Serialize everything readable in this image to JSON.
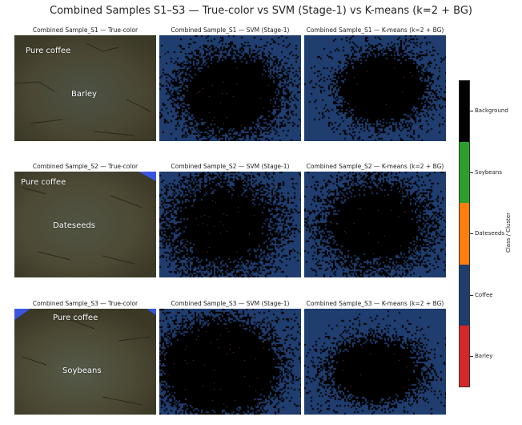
{
  "figure": {
    "title": "Combined Samples S1–S3 — True-color vs SVM (Stage-1) vs K-means (k=2 + BG)"
  },
  "rows": [
    {
      "sample": "S1",
      "truecolor_title": "Combined Sample_S1 — True-color",
      "svm_title": "Combined Sample_S1 — SVM (Stage-1)",
      "kmeans_title": "Combined Sample_S1 — K-means (k=2 + BG)",
      "label_top": "Pure coffee",
      "label_center": "Barley"
    },
    {
      "sample": "S2",
      "truecolor_title": "Combined Sample_S2 — True-color",
      "svm_title": "Combined Sample_S2 — SVM (Stage-1)",
      "kmeans_title": "Combined Sample_S2 — K-means (k=2 + BG)",
      "label_top": "Pure coffee",
      "label_center": "Dateseeds"
    },
    {
      "sample": "S3",
      "truecolor_title": "Combined Sample_S3 — True-color",
      "svm_title": "Combined Sample_S3 — SVM (Stage-1)",
      "kmeans_title": "Combined Sample_S3 — K-means (k=2 + BG)",
      "label_top": "Pure coffee",
      "label_center": "Soybeans"
    }
  ],
  "colorbar": {
    "title": "Class / Cluster",
    "classes": [
      {
        "label": "Background",
        "color": "#000000"
      },
      {
        "label": "Soybeans",
        "color": "#2ca02c"
      },
      {
        "label": "Dateseeds",
        "color": "#ff7f0e"
      },
      {
        "label": "Coffee",
        "color": "#1f3d6e"
      },
      {
        "label": "Barley",
        "color": "#d62728"
      }
    ]
  },
  "colors": {
    "coffee": "#1f3d6e",
    "background": "#000000",
    "truecolor_base": "#4a4a33"
  }
}
